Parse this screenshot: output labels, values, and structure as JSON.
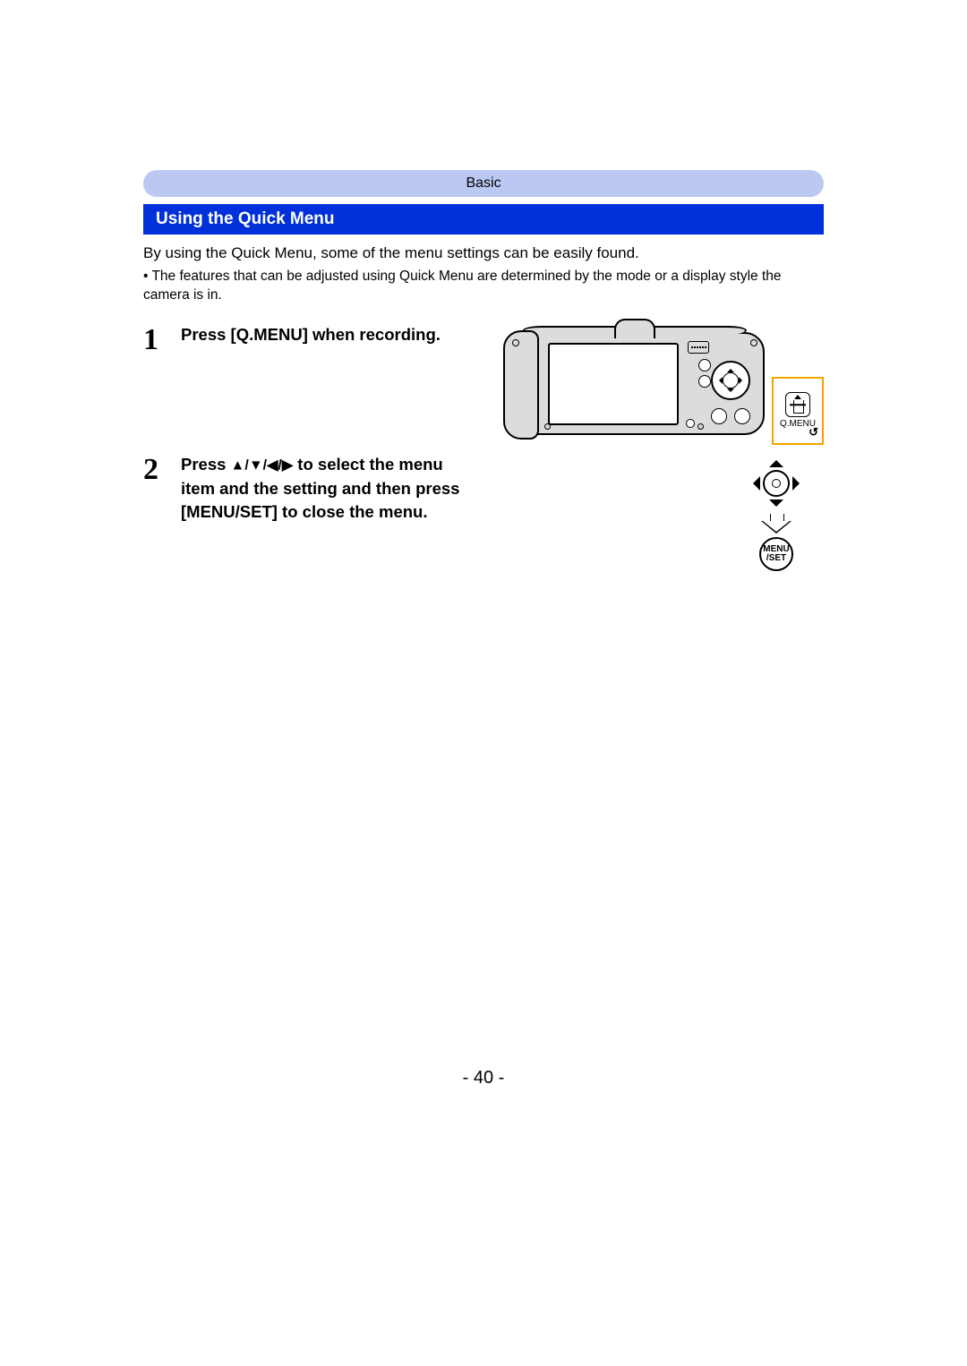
{
  "section_label": "Basic",
  "title": "Using the Quick Menu",
  "intro": "By using the Quick Menu, some of the menu settings can be easily found.",
  "note_bullet": "• ",
  "note": "The features that can be adjusted using Quick Menu are determined by the mode or a display style the camera is in.",
  "steps": [
    {
      "num": "1",
      "text": "Press [Q.MENU] when recording."
    },
    {
      "num": "2",
      "pre": "Press ",
      "arrows": "▲/▼/◀/▶",
      "post": " to select the menu item and the setting and then press [MENU/SET] to close the menu."
    }
  ],
  "camera_detail_label": "Q.MENU",
  "camera_detail_return": "↺",
  "menuset_top": "MENU",
  "menuset_bottom": "/SET",
  "page_number": "- 40 -"
}
